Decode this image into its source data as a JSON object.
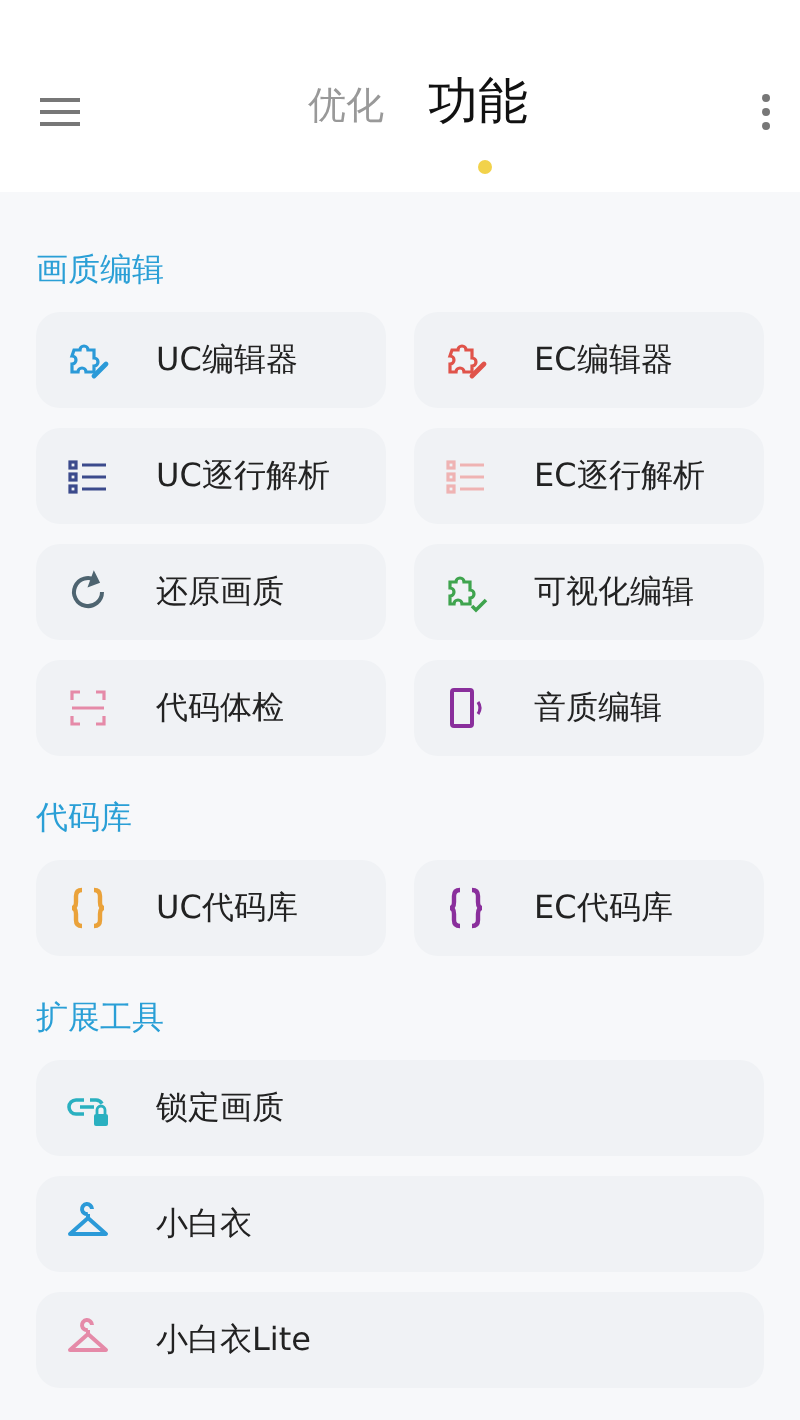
{
  "header": {
    "tabs": [
      {
        "label": "优化",
        "selected": false
      },
      {
        "label": "功能",
        "selected": true
      }
    ]
  },
  "sections": [
    {
      "title": "画质编辑",
      "kind": "grid",
      "items": [
        {
          "label": "UC编辑器",
          "kind": "puzzle-pen",
          "color": "#2b9ad8"
        },
        {
          "label": "EC编辑器",
          "kind": "puzzle-pen",
          "color": "#e0534a"
        },
        {
          "label": "UC逐行解析",
          "kind": "list",
          "color": "#3b4a8c"
        },
        {
          "label": "EC逐行解析",
          "kind": "list",
          "color": "#efb3b3"
        },
        {
          "label": "还原画质",
          "kind": "refresh",
          "color": "#4e6470"
        },
        {
          "label": "可视化编辑",
          "kind": "puzzle-check",
          "color": "#3fa44e"
        },
        {
          "label": "代码体检",
          "kind": "scan",
          "color": "#e58aa8"
        },
        {
          "label": "音质编辑",
          "kind": "phone-sound",
          "color": "#8a2f9c"
        }
      ]
    },
    {
      "title": "代码库",
      "kind": "grid",
      "items": [
        {
          "label": "UC代码库",
          "kind": "braces",
          "color": "#eaa23a"
        },
        {
          "label": "EC代码库",
          "kind": "braces",
          "color": "#8a2f9c"
        }
      ]
    },
    {
      "title": "扩展工具",
      "kind": "list",
      "items": [
        {
          "label": "锁定画质",
          "kind": "link-lock",
          "color": "#2ab0c0"
        },
        {
          "label": "小白衣",
          "kind": "hanger",
          "color": "#2b9ad8"
        },
        {
          "label": "小白衣Lite",
          "kind": "hanger",
          "color": "#e58aa8"
        }
      ]
    }
  ]
}
